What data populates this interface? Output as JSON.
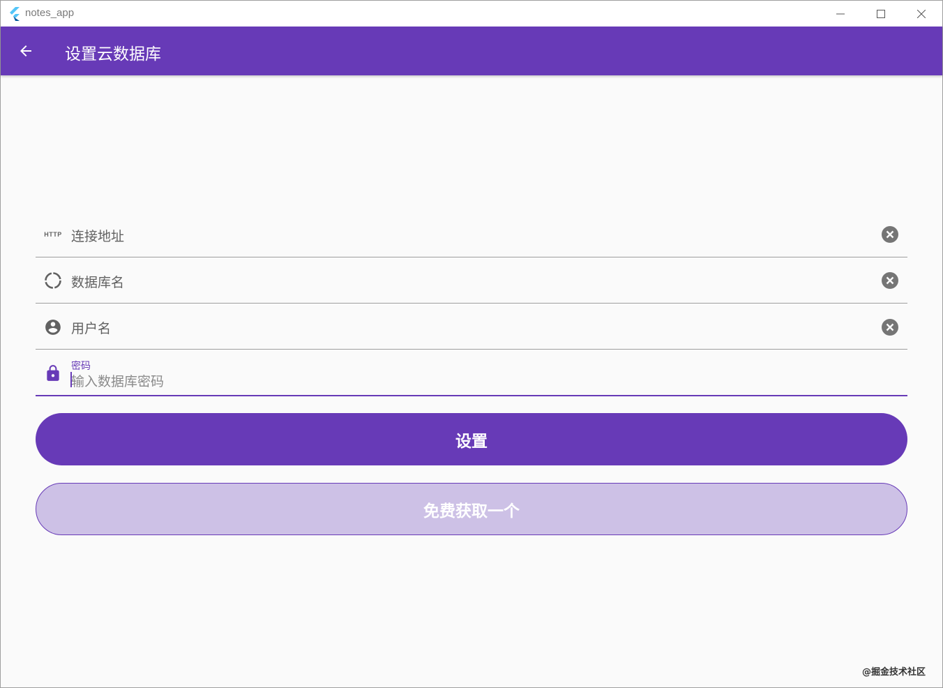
{
  "window": {
    "title": "notes_app"
  },
  "appbar": {
    "title": "设置云数据库"
  },
  "form": {
    "url_field": {
      "label": "连接地址",
      "icon": "http-icon"
    },
    "db_field": {
      "label": "数据库名",
      "icon": "loading-icon"
    },
    "user_field": {
      "label": "用户名",
      "icon": "account-circle-icon"
    },
    "password_field": {
      "label": "密码",
      "placeholder": "输入数据库密码",
      "icon": "lock-icon"
    }
  },
  "buttons": {
    "set_label": "设置",
    "get_free_label": "免费获取一个"
  },
  "watermark": "@掘金技术社区",
  "colors": {
    "primary": "#673ab7",
    "secondary_button_fill": "#cdc1e6",
    "background": "#fafafa"
  }
}
